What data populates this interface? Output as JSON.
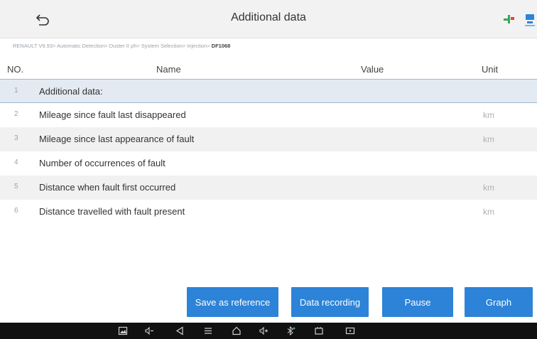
{
  "header": {
    "title": "Additional data",
    "back_icon": "back-arrow-icon",
    "right_icons": [
      "green-tool-icon",
      "blue-device-icon"
    ]
  },
  "breadcrumb": {
    "path": "RENAULT V9.93> Automatic Detection> Duster II ph> System Selection> Injection> ",
    "current": "DF1068"
  },
  "table": {
    "columns": {
      "no": "NO.",
      "name": "Name",
      "value": "Value",
      "unit": "Unit"
    },
    "rows": [
      {
        "no": "1",
        "name": "Additional data:",
        "value": "",
        "unit": ""
      },
      {
        "no": "2",
        "name": "Mileage since fault last disappeared",
        "value": "",
        "unit": "km"
      },
      {
        "no": "3",
        "name": "Mileage since last appearance of fault",
        "value": "",
        "unit": "km"
      },
      {
        "no": "4",
        "name": "Number of occurrences of fault",
        "value": "",
        "unit": ""
      },
      {
        "no": "5",
        "name": "Distance when fault first occurred",
        "value": "",
        "unit": "km"
      },
      {
        "no": "6",
        "name": "Distance travelled with fault present",
        "value": "",
        "unit": "km"
      }
    ]
  },
  "buttons": {
    "save_reference": "Save as reference",
    "data_recording": "Data recording",
    "pause": "Pause",
    "graph": "Graph"
  },
  "colors": {
    "accent": "#2c83d7",
    "header_bg": "#f2f2f2",
    "selected_row": "#e3eaf2",
    "navbar": "#111111"
  },
  "navbar": {
    "icons": [
      "screenshot-icon",
      "volume-down-icon",
      "back-icon",
      "menu-icon",
      "home-icon",
      "volume-up-icon",
      "bluetooth-icon",
      "vci-icon",
      "recent-apps-icon"
    ]
  }
}
